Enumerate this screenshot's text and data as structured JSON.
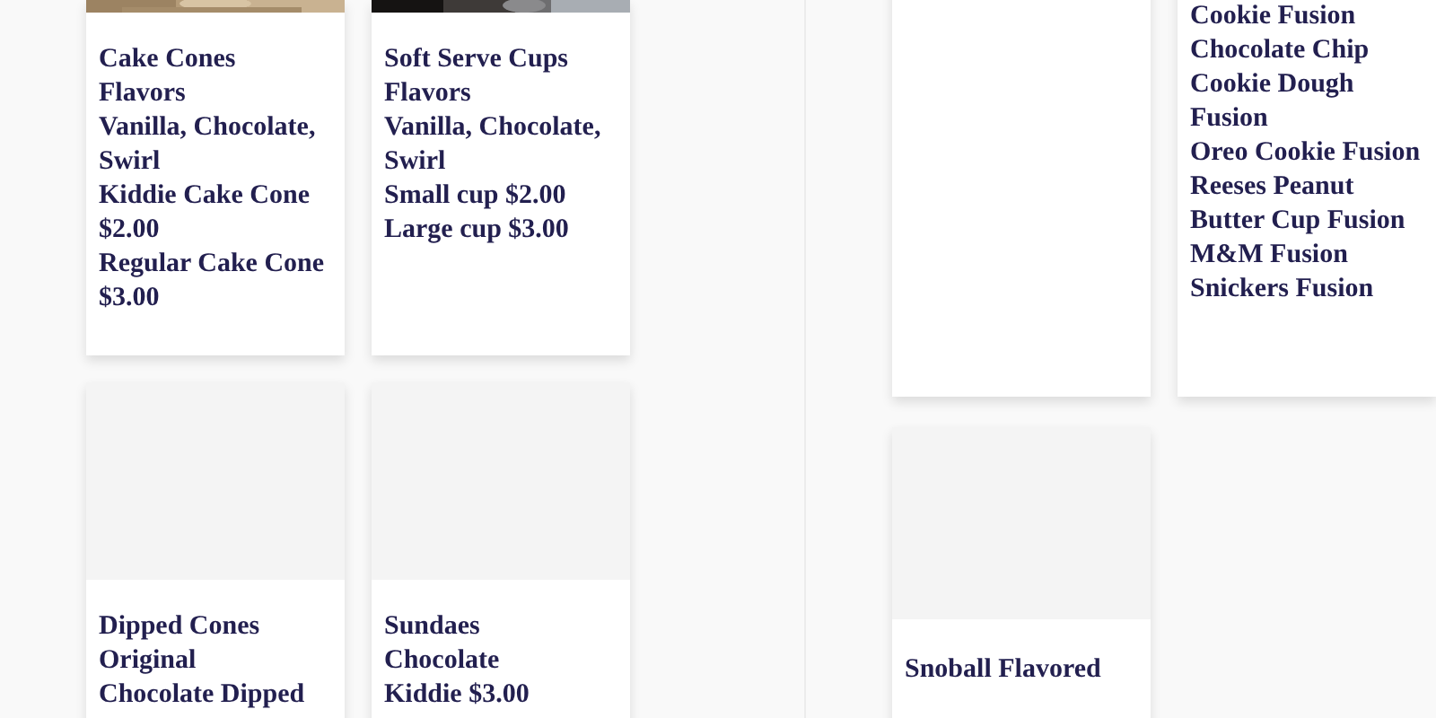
{
  "panels": [
    {
      "cards": [
        {
          "lines": [
            "Cake Cones",
            "Flavors",
            "Vanilla, Chocolate, Swirl",
            "Kiddie Cake Cone $2.00",
            "Regular Cake Cone $3.00"
          ]
        },
        {
          "lines": [
            "Soft Serve Cups",
            "Flavors",
            "Vanilla, Chocolate, Swirl",
            "Small cup $2.00",
            "Large cup $3.00"
          ]
        },
        {
          "kind": "placeholder",
          "lines": [
            "Dipped Cones",
            "Original",
            "Chocolate Dipped"
          ]
        },
        {
          "kind": "placeholder",
          "lines": [
            "Sundaes",
            "Chocolate",
            "Kiddie $3.00"
          ]
        }
      ]
    },
    {
      "cards": [
        {
          "kind": "blank"
        },
        {
          "kind": "text",
          "lines": [
            "Cookie Fusion",
            "Chocolate Chip Cookie Dough Fusion",
            "Oreo Cookie Fusion",
            "Reeses Peanut Butter Cup Fusion",
            "M&M Fusion",
            "Snickers Fusion"
          ]
        },
        {
          "kind": "placeholder",
          "lines": [
            "Snoball Flavored"
          ]
        }
      ]
    }
  ]
}
